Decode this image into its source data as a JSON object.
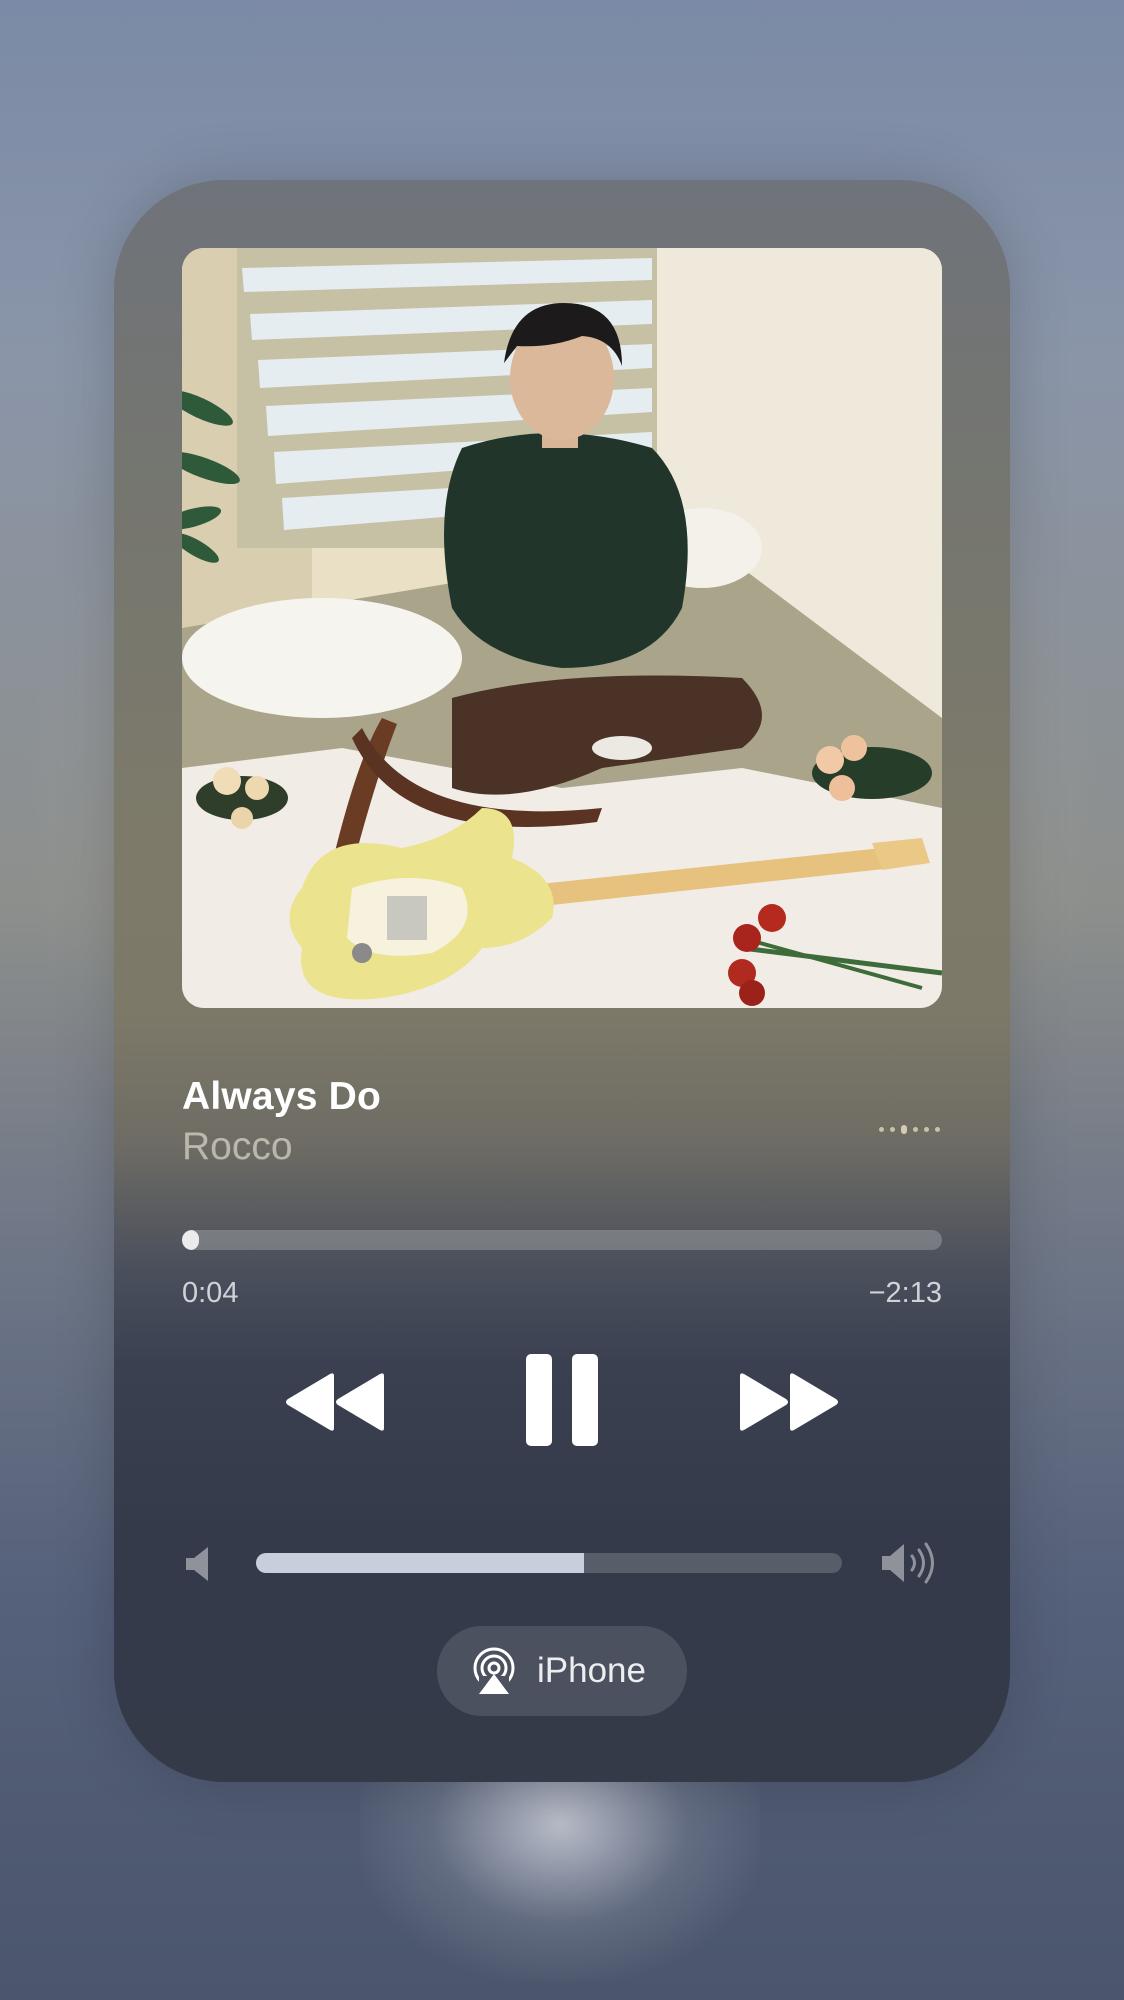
{
  "now_playing": {
    "title": "Always Do",
    "artist": "Rocco",
    "elapsed": "0:04",
    "remaining": "−2:13",
    "progress_fraction": 0.022,
    "volume_fraction": 0.56
  },
  "controls": {
    "rewind_icon": "rewind-icon",
    "pause_icon": "pause-icon",
    "forward_icon": "fast-forward-icon",
    "more_icon": "more-dots-icon"
  },
  "output": {
    "device_label": "iPhone",
    "icon": "airplay-icon"
  },
  "colors": {
    "text_primary": "#ffffff",
    "text_secondary": "#c9c2ad",
    "progress_fill": "#e6e6e6",
    "volume_fill": "#dce2f0"
  }
}
